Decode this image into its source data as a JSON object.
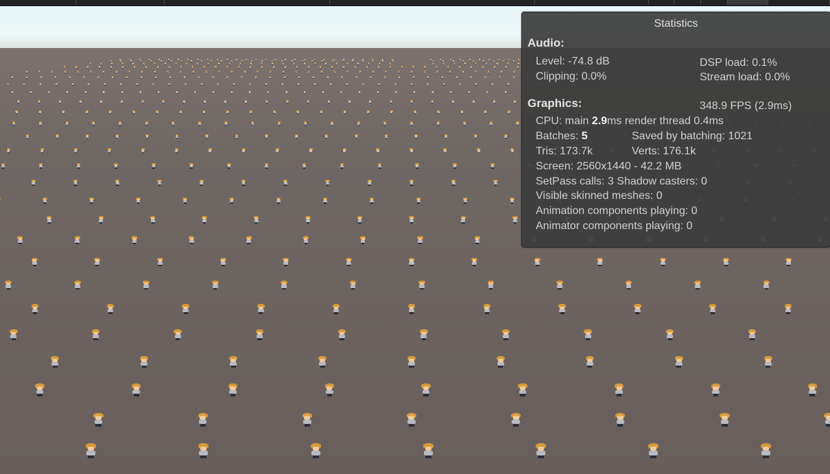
{
  "statistics": {
    "title": "Statistics",
    "audio": {
      "heading": "Audio:",
      "level": "Level: -74.8 dB",
      "clipping": "Clipping: 0.0%",
      "dsp_load": "DSP load: 0.1%",
      "stream_load": "Stream load: 0.0%"
    },
    "graphics": {
      "heading": "Graphics:",
      "fps": "348.9 FPS (2.9ms)",
      "cpu_prefix": "CPU: main ",
      "cpu_main": "2.9",
      "cpu_suffix": "ms  render thread 0.4ms",
      "batches_prefix": "Batches: ",
      "batches": "5",
      "saved_by_batching": "Saved by batching: 1021",
      "tris": "Tris: 173.7k",
      "verts": "Verts: 176.1k",
      "screen": "Screen: 2560x1440 - 42.2 MB",
      "setpass": "SetPass calls: 3 Shadow casters: 0",
      "visible_skinned": "Visible skinned meshes: 0",
      "animation_components": "Animation components playing: 0",
      "animator_components": "Animator components playing: 0"
    }
  },
  "colors": {
    "panel_bg": "#3c3c3c",
    "ground": "#6b625f",
    "sky": "#eef8f9",
    "sprite_hair": "#d79a3c"
  }
}
